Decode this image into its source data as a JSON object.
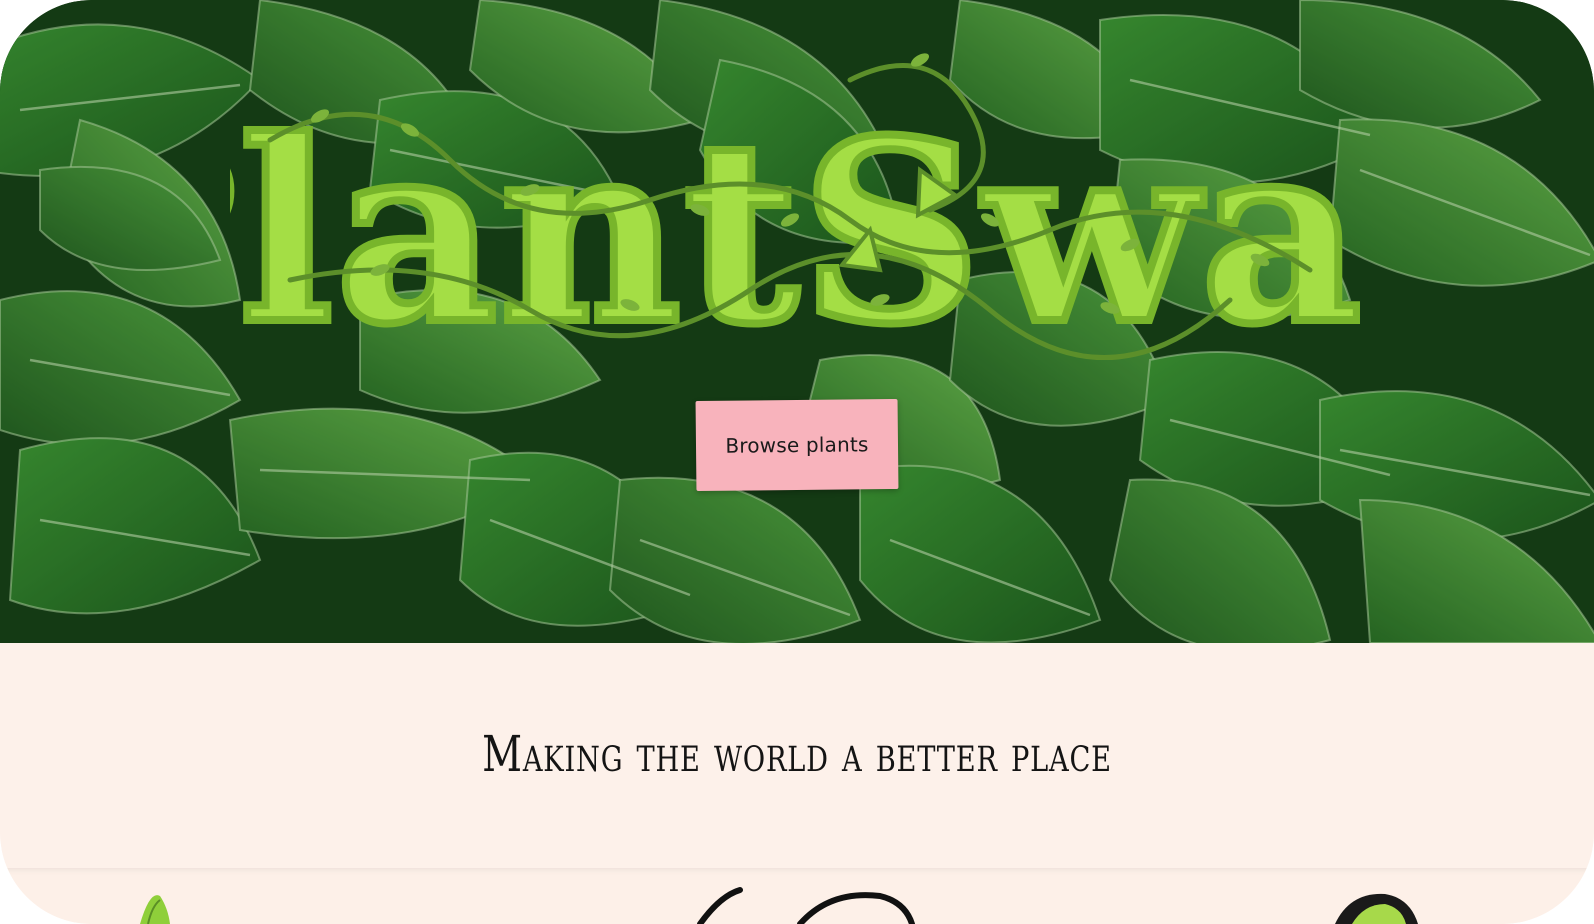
{
  "hero": {
    "logo_text": "PlantSwap",
    "logo_colors": {
      "letter_fill": "#a4de45",
      "letter_outline": "#78b52b",
      "vine": "#5c8f2a"
    },
    "browse_button_label": "Browse plants",
    "browse_button_color": "#f8b3bc"
  },
  "tagline_section": {
    "tagline": "Making the world a better place",
    "background": "#fdf1ea"
  },
  "colors": {
    "leaf_dark": "#1b4d1c",
    "leaf_mid": "#2f7a2b",
    "leaf_light": "#4ea33e"
  }
}
